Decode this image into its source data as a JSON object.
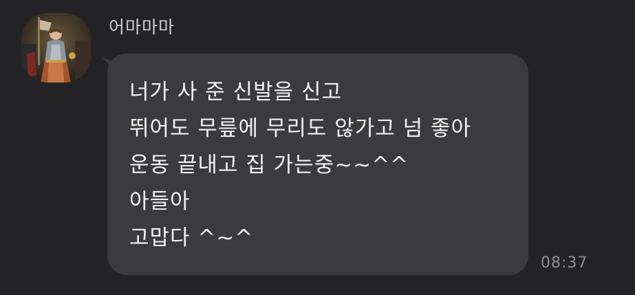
{
  "conversation": {
    "sender_name": "어마마마",
    "avatar_icon": "profile-avatar-painting",
    "message_lines": [
      "너가 사 준 신발을 신고",
      "뛰어도 무릎에 무리도 않가고 넘 좋아",
      "운동 끝내고 집 가는중~~^^",
      "아들아",
      "고맙다 ^~^"
    ],
    "time": "08:37"
  },
  "colors": {
    "background": "#232325",
    "bubble": "#3b3b3e",
    "text": "#f2f2f2",
    "meta_text": "#8d8d90"
  }
}
